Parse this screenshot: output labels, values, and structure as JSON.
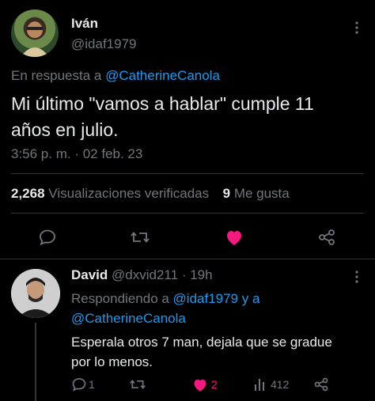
{
  "tweet": {
    "author_name": "Iván",
    "author_handle": "@idaf1979",
    "reply_prefix": "En respuesta a ",
    "reply_to": "@CatherineCanola",
    "text_line1": "Mi último \"vamos a hablar\" cumple 11",
    "text_line2": "años en julio.",
    "timestamp": "3:56 p. m. · 02 feb. 23",
    "views_count": "2,268",
    "views_label": "Visualizaciones verificadas",
    "likes_count": "9",
    "likes_label": "Me gusta"
  },
  "reply": {
    "author_name": "David",
    "author_handle": "@dxvid211",
    "separator": "·",
    "time": "19h",
    "replying_prefix": "Respondiendo a ",
    "replying_to_1": "@idaf1979",
    "replying_conj": " y a",
    "replying_to_2": "@CatherineCanola",
    "text_line1": "Esperala otros 7 man, dejala que se gradue",
    "text_line2": "por lo menos.",
    "reply_count": "1",
    "like_count": "2",
    "view_count": "412"
  },
  "colors": {
    "background": "#000000",
    "text": "#e7e9ea",
    "muted": "#71767b",
    "link": "#1d9bf0",
    "like": "#f91880",
    "divider": "#2f3336"
  },
  "icons": [
    "reply-icon",
    "retweet-icon",
    "like-icon",
    "share-icon",
    "views-icon",
    "more-icon"
  ]
}
